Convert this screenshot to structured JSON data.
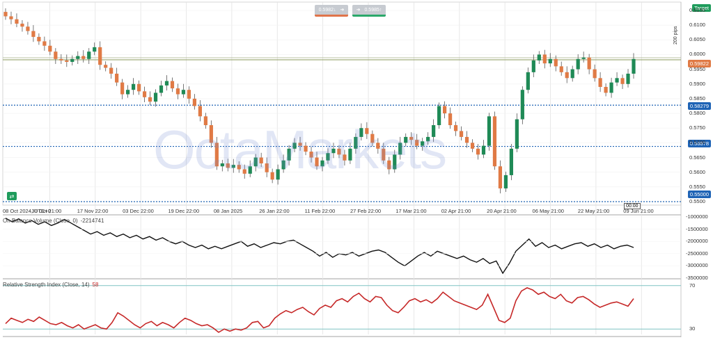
{
  "toolbar": {
    "sell_price": "0.5982↓",
    "sell_arrow": "➜",
    "buy_arrow": "➜",
    "buy_price": "0.5985↑"
  },
  "watermark": "OctaMarkets",
  "badges": {
    "target": "Target",
    "current_price": "0.59822",
    "level1": "0.58279",
    "level2": "0.56878",
    "level3": "0.55000"
  },
  "pips_label": "200 pips",
  "time_marker": "00:00",
  "currency_button_icon": "currency-exchange-icon",
  "colors": {
    "up": "#1f8a56",
    "down": "#e07a45",
    "level": "#1e63b5",
    "obv": "#111111",
    "rsi": "#c62828",
    "target": "#1f9c5c",
    "current": "#e07a45"
  },
  "chart_data": [
    {
      "type": "candlestick",
      "x_axis_labels": [
        "08 Oct 2024, UTC+0",
        "30 Oct 21:00",
        "17 Nov 22:00",
        "03 Dec 22:00",
        "19 Dec 22:00",
        "08 Jan 2025",
        "26 Jan 22:00",
        "11 Feb 22:00",
        "27 Feb 22:00",
        "17 Mar 21:00",
        "02 Apr 21:00",
        "20 Apr 21:00",
        "06 May 21:00",
        "22 May 21:00",
        "09 Jun 21:00"
      ],
      "y_ticks": [
        "0.6150",
        "0.6100",
        "0.6050",
        "0.6000",
        "0.5950",
        "0.5900",
        "0.5850",
        "0.5800",
        "0.5750",
        "0.5700",
        "0.5650",
        "0.5600",
        "0.5550",
        "0.5500"
      ],
      "ylim": [
        0.55,
        0.615
      ],
      "close_series": [
        0.613,
        0.612,
        0.6105,
        0.6095,
        0.608,
        0.606,
        0.6045,
        0.603,
        0.601,
        0.5985,
        0.598,
        0.5975,
        0.5985,
        0.5995,
        0.5985,
        0.601,
        0.6025,
        0.5965,
        0.5955,
        0.5935,
        0.5905,
        0.5865,
        0.588,
        0.59,
        0.5875,
        0.5855,
        0.584,
        0.587,
        0.5895,
        0.591,
        0.5885,
        0.5865,
        0.588,
        0.585,
        0.5825,
        0.579,
        0.576,
        0.57,
        0.562,
        0.563,
        0.5615,
        0.5625,
        0.561,
        0.5595,
        0.562,
        0.565,
        0.563,
        0.56,
        0.5575,
        0.561,
        0.564,
        0.568,
        0.57,
        0.569,
        0.567,
        0.565,
        0.562,
        0.564,
        0.5665,
        0.568,
        0.566,
        0.564,
        0.568,
        0.572,
        0.575,
        0.573,
        0.57,
        0.568,
        0.564,
        0.561,
        0.566,
        0.57,
        0.572,
        0.571,
        0.569,
        0.5705,
        0.572,
        0.576,
        0.5825,
        0.58,
        0.576,
        0.574,
        0.572,
        0.57,
        0.568,
        0.566,
        0.569,
        0.579,
        0.562,
        0.5545,
        0.559,
        0.568,
        0.578,
        0.588,
        0.594,
        0.598,
        0.6,
        0.597,
        0.5985,
        0.596,
        0.594,
        0.592,
        0.595,
        0.5985,
        0.599,
        0.595,
        0.592,
        0.589,
        0.587,
        0.5905,
        0.592,
        0.59,
        0.5935,
        0.5985
      ],
      "price_levels": [
        0.58279,
        0.56878,
        0.55
      ],
      "current_price": 0.59822
    },
    {
      "type": "line",
      "title": "On Balance Volume (Close, 0)",
      "value_label": "-2214741",
      "y_ticks": [
        "-1000000",
        "-1500000",
        "-2000000",
        "-2500000",
        "-3000000",
        "-3500000"
      ],
      "ylim": [
        -3500000,
        -1000000
      ],
      "values": [
        -1050000,
        -1200000,
        -1080000,
        -1250000,
        -1150000,
        -1300000,
        -1200000,
        -1350000,
        -1250000,
        -1100000,
        -1250000,
        -1400000,
        -1550000,
        -1700000,
        -1600000,
        -1750000,
        -1650000,
        -1800000,
        -1700000,
        -1850000,
        -1750000,
        -1900000,
        -1800000,
        -1950000,
        -1850000,
        -2000000,
        -2100000,
        -2000000,
        -2150000,
        -2250000,
        -2150000,
        -2300000,
        -2200000,
        -2300000,
        -2200000,
        -2100000,
        -2000000,
        -2200000,
        -2100000,
        -2250000,
        -2150000,
        -2050000,
        -2100000,
        -2000000,
        -1950000,
        -2100000,
        -2250000,
        -2400000,
        -2600000,
        -2450000,
        -2650000,
        -2500000,
        -2550000,
        -2450000,
        -2600000,
        -2500000,
        -2400000,
        -2350000,
        -2450000,
        -2650000,
        -2850000,
        -3000000,
        -2800000,
        -2600000,
        -2450000,
        -2600000,
        -2400000,
        -2500000,
        -2600000,
        -2700000,
        -2600000,
        -2750000,
        -2850000,
        -2700000,
        -2900000,
        -2800000,
        -3300000,
        -2900000,
        -2400000,
        -2150000,
        -1900000,
        -2200000,
        -2050000,
        -2250000,
        -2150000,
        -2300000,
        -2200000,
        -2100000,
        -2050000,
        -2200000,
        -2100000,
        -2250000,
        -2150000,
        -2300000,
        -2200000,
        -2150000,
        -2250000
      ],
      "xlim_count": 97
    },
    {
      "type": "line",
      "title": "Relative Strength Index (Close, 14)",
      "value_label": "58",
      "y_ticks": [
        "70",
        "30"
      ],
      "ylim": [
        25,
        75
      ],
      "values": [
        35,
        40,
        38,
        36,
        39,
        37,
        41,
        38,
        35,
        34,
        36,
        33,
        31,
        34,
        30,
        32,
        34,
        31,
        30,
        36,
        45,
        42,
        38,
        34,
        31,
        35,
        37,
        33,
        36,
        34,
        31,
        36,
        40,
        38,
        35,
        33,
        34,
        31,
        27,
        30,
        28,
        30,
        29,
        31,
        36,
        37,
        31,
        33,
        40,
        44,
        47,
        45,
        48,
        50,
        46,
        43,
        49,
        52,
        50,
        56,
        58,
        55,
        60,
        63,
        58,
        55,
        60,
        59,
        52,
        47,
        45,
        50,
        56,
        58,
        55,
        57,
        54,
        58,
        64,
        60,
        56,
        54,
        52,
        50,
        48,
        52,
        62,
        50,
        38,
        36,
        40,
        56,
        65,
        68,
        66,
        62,
        64,
        60,
        58,
        62,
        56,
        54,
        59,
        60,
        57,
        53,
        50,
        52,
        54,
        55,
        53,
        51,
        58
      ],
      "levels": [
        70,
        30
      ]
    }
  ]
}
